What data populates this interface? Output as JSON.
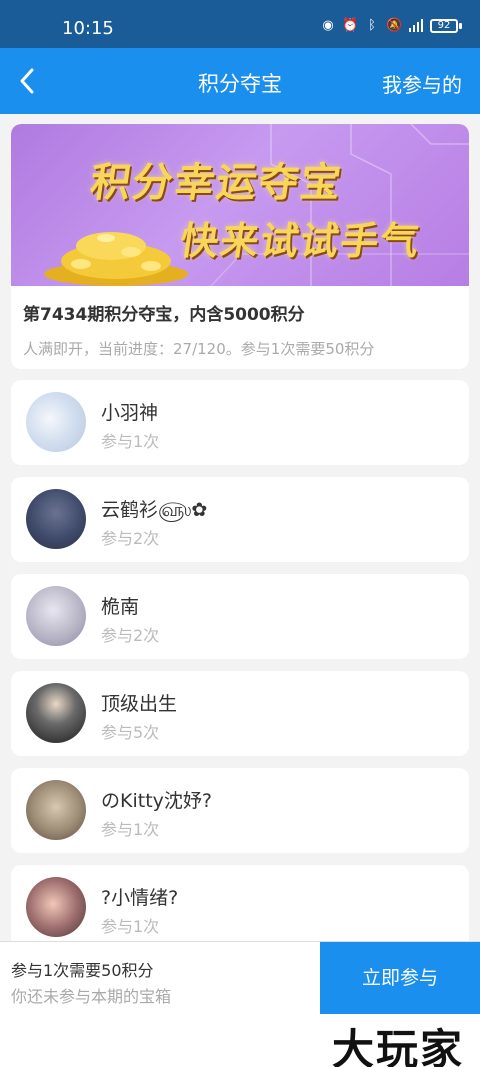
{
  "status": {
    "time": "10:15",
    "battery": "92"
  },
  "nav": {
    "title": "积分夺宝",
    "mine": "我参与的"
  },
  "banner": {
    "line1": "积分幸运夺宝",
    "line2": "快来试试手气"
  },
  "issue": {
    "title": "第7434期积分夺宝，内含5000积分",
    "desc": "人满即开，当前进度：27/120。参与1次需要50积分"
  },
  "participants": [
    {
      "name": "小羽神",
      "count": "参与1次",
      "avatar_color": "#d7e3f2"
    },
    {
      "name": "云鹤衫௵✿",
      "count": "参与2次",
      "avatar_color": "#3f4a6b"
    },
    {
      "name": "桅南",
      "count": "参与2次",
      "avatar_color": "#b8b6c6"
    },
    {
      "name": "顶级出生",
      "count": "参与5次",
      "avatar_color": "#2a2a2a"
    },
    {
      "name": "のKitty沈妤?",
      "count": "参与1次",
      "avatar_color": "#9b8a74"
    },
    {
      "name": "?小情绪?",
      "count": "参与1次",
      "avatar_color": "#7a5a5a"
    }
  ],
  "bottom": {
    "cost": "参与1次需要50积分",
    "status": "你还未参与本期的宝箱",
    "join": "立即参与",
    "watermark": "大玩家"
  },
  "colors": {
    "primary": "#1a8fed",
    "statusbar": "#1a5c98"
  }
}
